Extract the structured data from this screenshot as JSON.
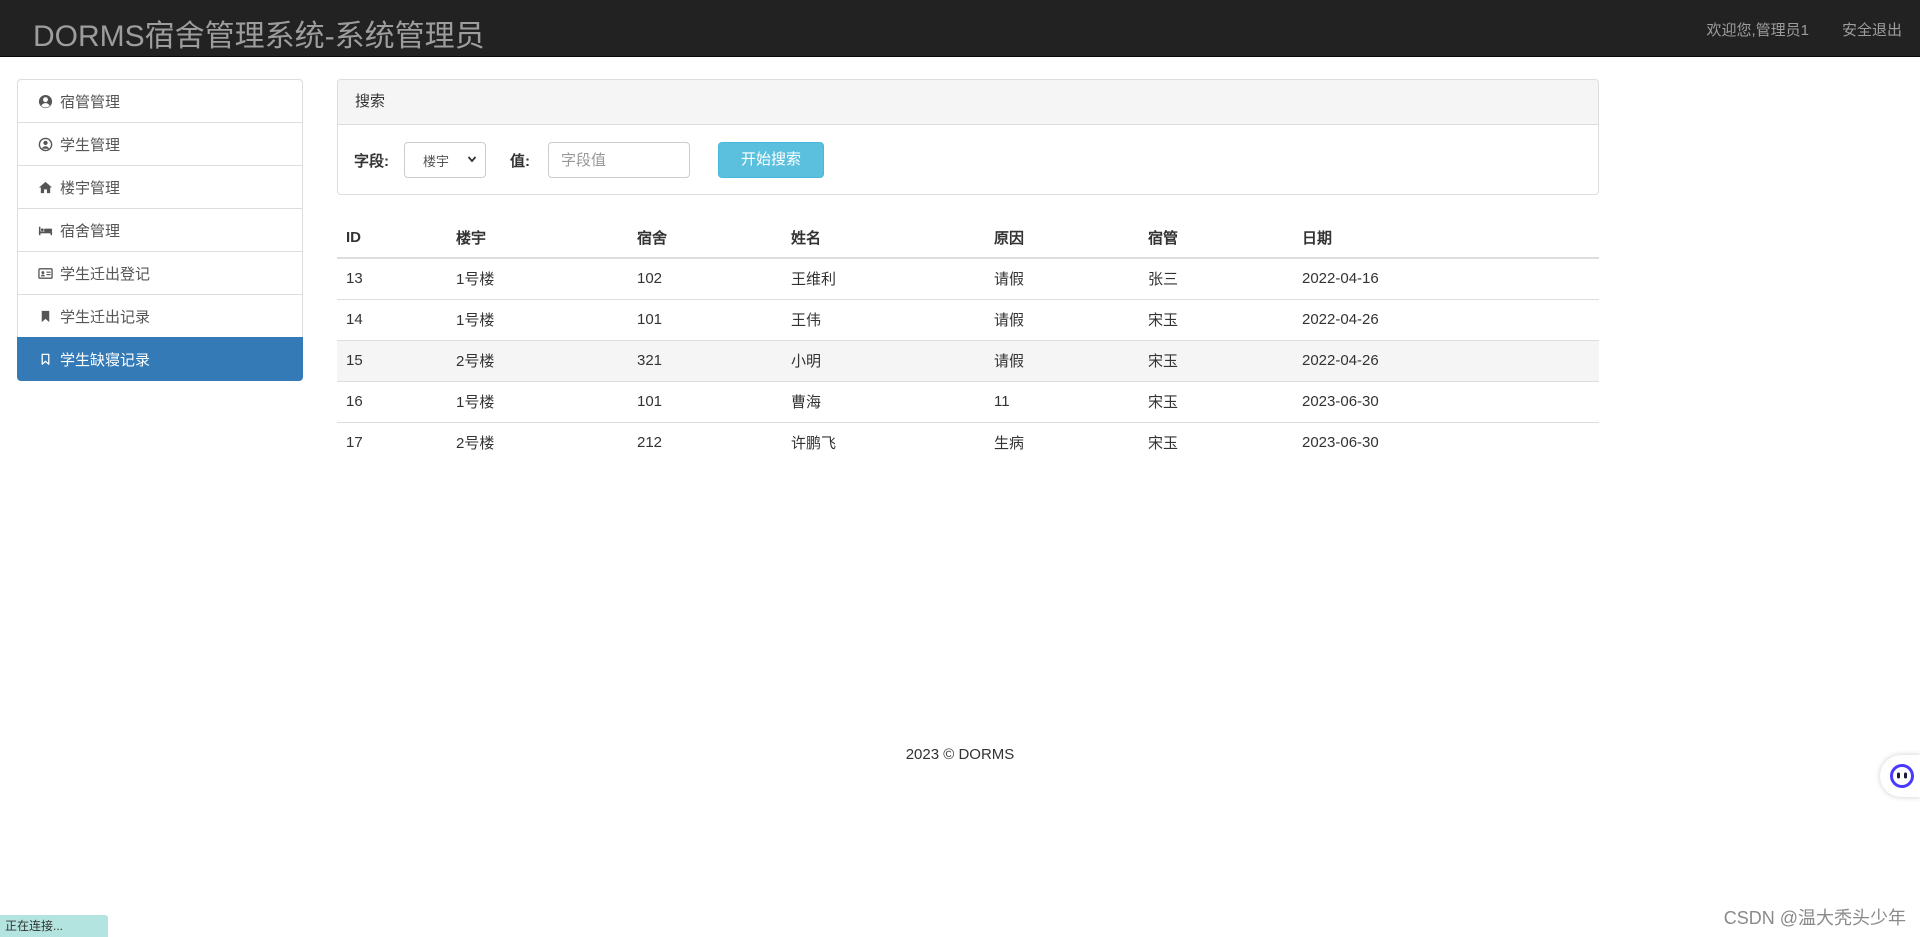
{
  "navbar": {
    "brand": "DORMS宿舍管理系统-系统管理员",
    "welcome": "欢迎您,管理员1",
    "logout": "安全退出"
  },
  "sidebar": {
    "items": [
      {
        "label": "宿管管理",
        "icon": "user-circle-icon"
      },
      {
        "label": "学生管理",
        "icon": "user-outline-icon"
      },
      {
        "label": "楼宇管理",
        "icon": "home-icon"
      },
      {
        "label": "宿舍管理",
        "icon": "bed-icon"
      },
      {
        "label": "学生迁出登记",
        "icon": "id-card-icon"
      },
      {
        "label": "学生迁出记录",
        "icon": "bookmark-icon"
      },
      {
        "label": "学生缺寝记录",
        "icon": "bookmark-outline-icon",
        "active": true
      }
    ]
  },
  "search": {
    "title": "搜索",
    "field_label": "字段:",
    "field_value": "楼宇",
    "value_label": "值:",
    "value_placeholder": "字段值",
    "button": "开始搜索"
  },
  "table": {
    "headers": [
      "ID",
      "楼宇",
      "宿舍",
      "姓名",
      "原因",
      "宿管",
      "日期"
    ],
    "rows": [
      [
        "13",
        "1号楼",
        "102",
        "王维利",
        "请假",
        "张三",
        "2022-04-16"
      ],
      [
        "14",
        "1号楼",
        "101",
        "王伟",
        "请假",
        "宋玉",
        "2022-04-26"
      ],
      [
        "15",
        "2号楼",
        "321",
        "小明",
        "请假",
        "宋玉",
        "2022-04-26"
      ],
      [
        "16",
        "1号楼",
        "101",
        "曹海",
        "11",
        "宋玉",
        "2023-06-30"
      ],
      [
        "17",
        "2号楼",
        "212",
        "许鹏飞",
        "生病",
        "宋玉",
        "2023-06-30"
      ]
    ]
  },
  "footer": "2023 © DORMS",
  "status": "正在连接...",
  "watermark": "CSDN @温大秃头少年",
  "colors": {
    "navbar": "#222222",
    "active": "#337ab7",
    "search_button": "#5bc0de"
  }
}
